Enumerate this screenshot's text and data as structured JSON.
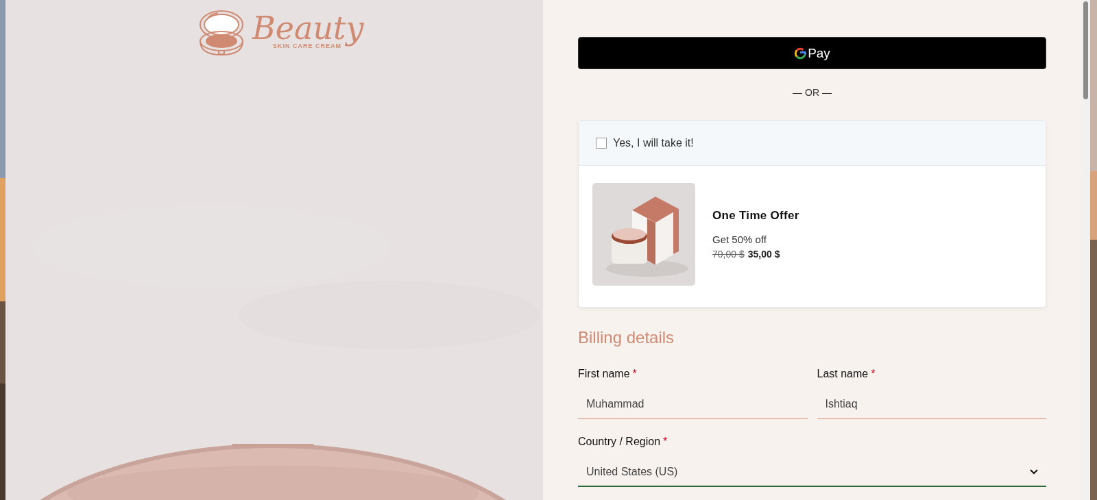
{
  "logo": {
    "name": "Beauty",
    "tagline": "SKIN CARE CREAM"
  },
  "express_checkout": {
    "label": "Pay"
  },
  "separator": "— OR —",
  "offer": {
    "checkbox_label": "Yes, I will take it!",
    "checked": false,
    "title": "One Time Offer",
    "description": "Get 50% off",
    "old_price": "70,00 $",
    "new_price": "35,00 $"
  },
  "billing": {
    "heading": "Billing details",
    "fields": [
      {
        "kind": "text",
        "label": "First name",
        "required_mark": "*",
        "value": "Muhammad",
        "focused": false
      },
      {
        "kind": "text",
        "label": "Last name",
        "required_mark": "*",
        "value": "Ishtiaq",
        "focused": false
      },
      {
        "kind": "select",
        "label": "Country / Region",
        "required_mark": "*",
        "value": "United States (US)",
        "focused": true
      }
    ]
  }
}
